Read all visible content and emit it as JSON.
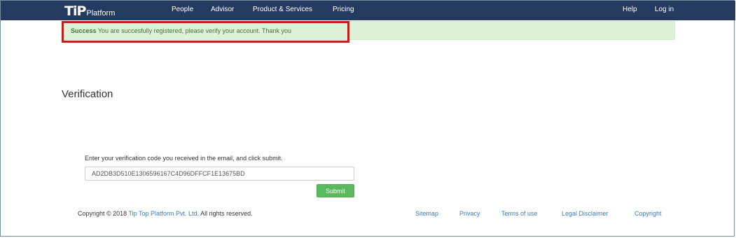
{
  "navbar": {
    "logo_tip": "TiP",
    "logo_platform": "Platform",
    "links": [
      "People",
      "Advisor",
      "Product & Services",
      "Pricing"
    ],
    "help": "Help",
    "login": "Log in"
  },
  "alert": {
    "strong": "Success",
    "message": "You are succesfully registered, please verify your account. Thank you"
  },
  "main": {
    "title": "Verification",
    "instructions": "Enter your verification code you received in the email, and click submit.",
    "code_value": "AD2DB3D510E1306596167C4D96DFFCF1E13675BD",
    "submit_label": "Submit"
  },
  "footer": {
    "copyright_prefix": "Copyright © 2018",
    "company": "Tip Top Platform Pvt. Ltd.",
    "copyright_suffix": "All rights reserved.",
    "links": [
      "Sitemap",
      "Privacy",
      "Terms of use",
      "Legal Disclaimer",
      "Copyright"
    ]
  },
  "colors": {
    "navbar": "#243a5e",
    "success_bg": "#dff0d8",
    "success_text": "#3c763d",
    "highlight": "#c0221b",
    "button": "#5cb85c",
    "link": "#3a7bbf"
  }
}
